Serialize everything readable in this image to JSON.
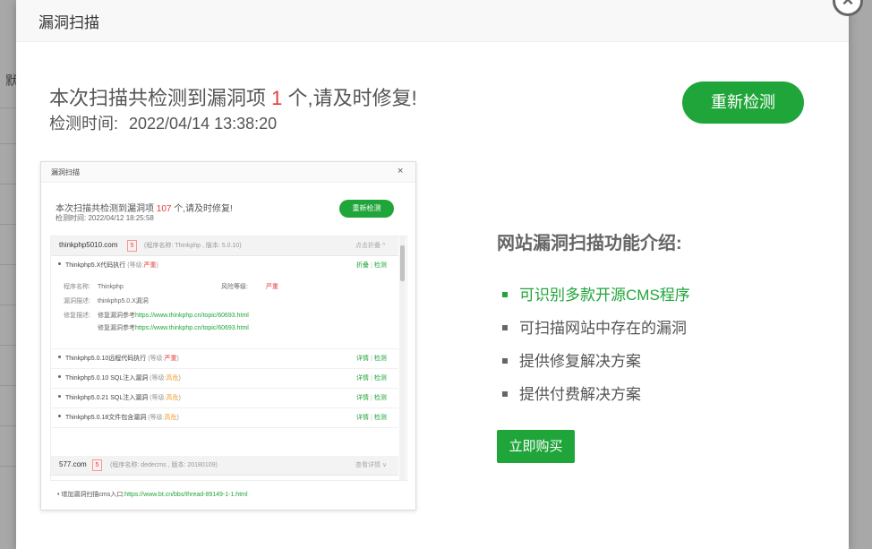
{
  "background": {
    "partial_text": "默"
  },
  "dialog": {
    "title": "漏洞扫描",
    "close_icon": "close-icon",
    "summary_prefix": "本次扫描共检测到漏洞项",
    "summary_count": "1",
    "summary_suffix": "个,请及时修复!",
    "time_label": "检测时间:",
    "time_value": "2022/04/14 13:38:20",
    "rescan_label": "重新检测"
  },
  "preview": {
    "title": "漏洞扫描",
    "close": "×",
    "summary_prefix": "本次扫描共检测到漏洞项",
    "summary_count": "107",
    "summary_suffix": "个,请及时修复!",
    "time": "检测时间: 2022/04/12 18:25:58",
    "rescan_label": "重新检测",
    "site1": {
      "name": "thinkphp5010.com",
      "badge": "5",
      "meta": "(程序名称: Thinkphp , 版本: 5.0.10)",
      "toggle": "点击折叠 ^"
    },
    "items": [
      {
        "name": "Thinkphp5.X代码执行",
        "level_label": "(等级:",
        "level": "严重",
        "level_close": ")",
        "act1": "折叠",
        "act2": "检测"
      },
      {
        "name": "Thinkphp5.0.10远程代码执行",
        "level_label": "(等级:",
        "level": "严重",
        "level_close": ")",
        "act1": "详情",
        "act2": "检测"
      },
      {
        "name": "Thinkphp5.0.10 SQL注入漏洞",
        "level_label": "(等级:",
        "level": "高危",
        "level_close": ")",
        "act1": "详情",
        "act2": "检测"
      },
      {
        "name": "Thinkphp5.0.21 SQL注入漏洞",
        "level_label": "(等级:",
        "level": "高危",
        "level_close": ")",
        "act1": "详情",
        "act2": "检测"
      },
      {
        "name": "Thinkphp5.0.18文件包含漏洞",
        "level_label": "(等级:",
        "level": "高危",
        "level_close": ")",
        "act1": "详情",
        "act2": "检测"
      }
    ],
    "detail": {
      "program_label": "程序名称:",
      "program": "Thinkphp",
      "risk_label": "风险等级:",
      "risk": "严重",
      "desc_label": "漏洞描述:",
      "desc": "thinkphp5.0.X漏洞",
      "fix_label": "修复描述:",
      "fix_text": "修复漏洞参考",
      "fix_url1": "https://www.thinkphp.cn/topic/60693.html",
      "fix_text2": "修复漏洞参考",
      "fix_url2": "https://www.thinkphp.cn/topic/60693.html"
    },
    "site2": {
      "name": "577.com",
      "badge": "5",
      "meta": "(程序名称: dedecms , 版本: 20180109)",
      "toggle": "查看详情 ∨"
    },
    "footer_text": "增加漏洞扫描cms入口:",
    "footer_link": "https://www.bt.cn/bbs/thread-89149-1-1.html"
  },
  "intro": {
    "title": "网站漏洞扫描功能介绍:",
    "features": [
      "可识别多款开源CMS程序",
      "可扫描网站中存在的漏洞",
      "提供修复解决方案",
      "提供付费解决方案"
    ],
    "buy_label": "立即购买"
  },
  "colors": {
    "accent": "#20a53a",
    "danger": "#e53c3c",
    "warning": "#f0a030"
  }
}
